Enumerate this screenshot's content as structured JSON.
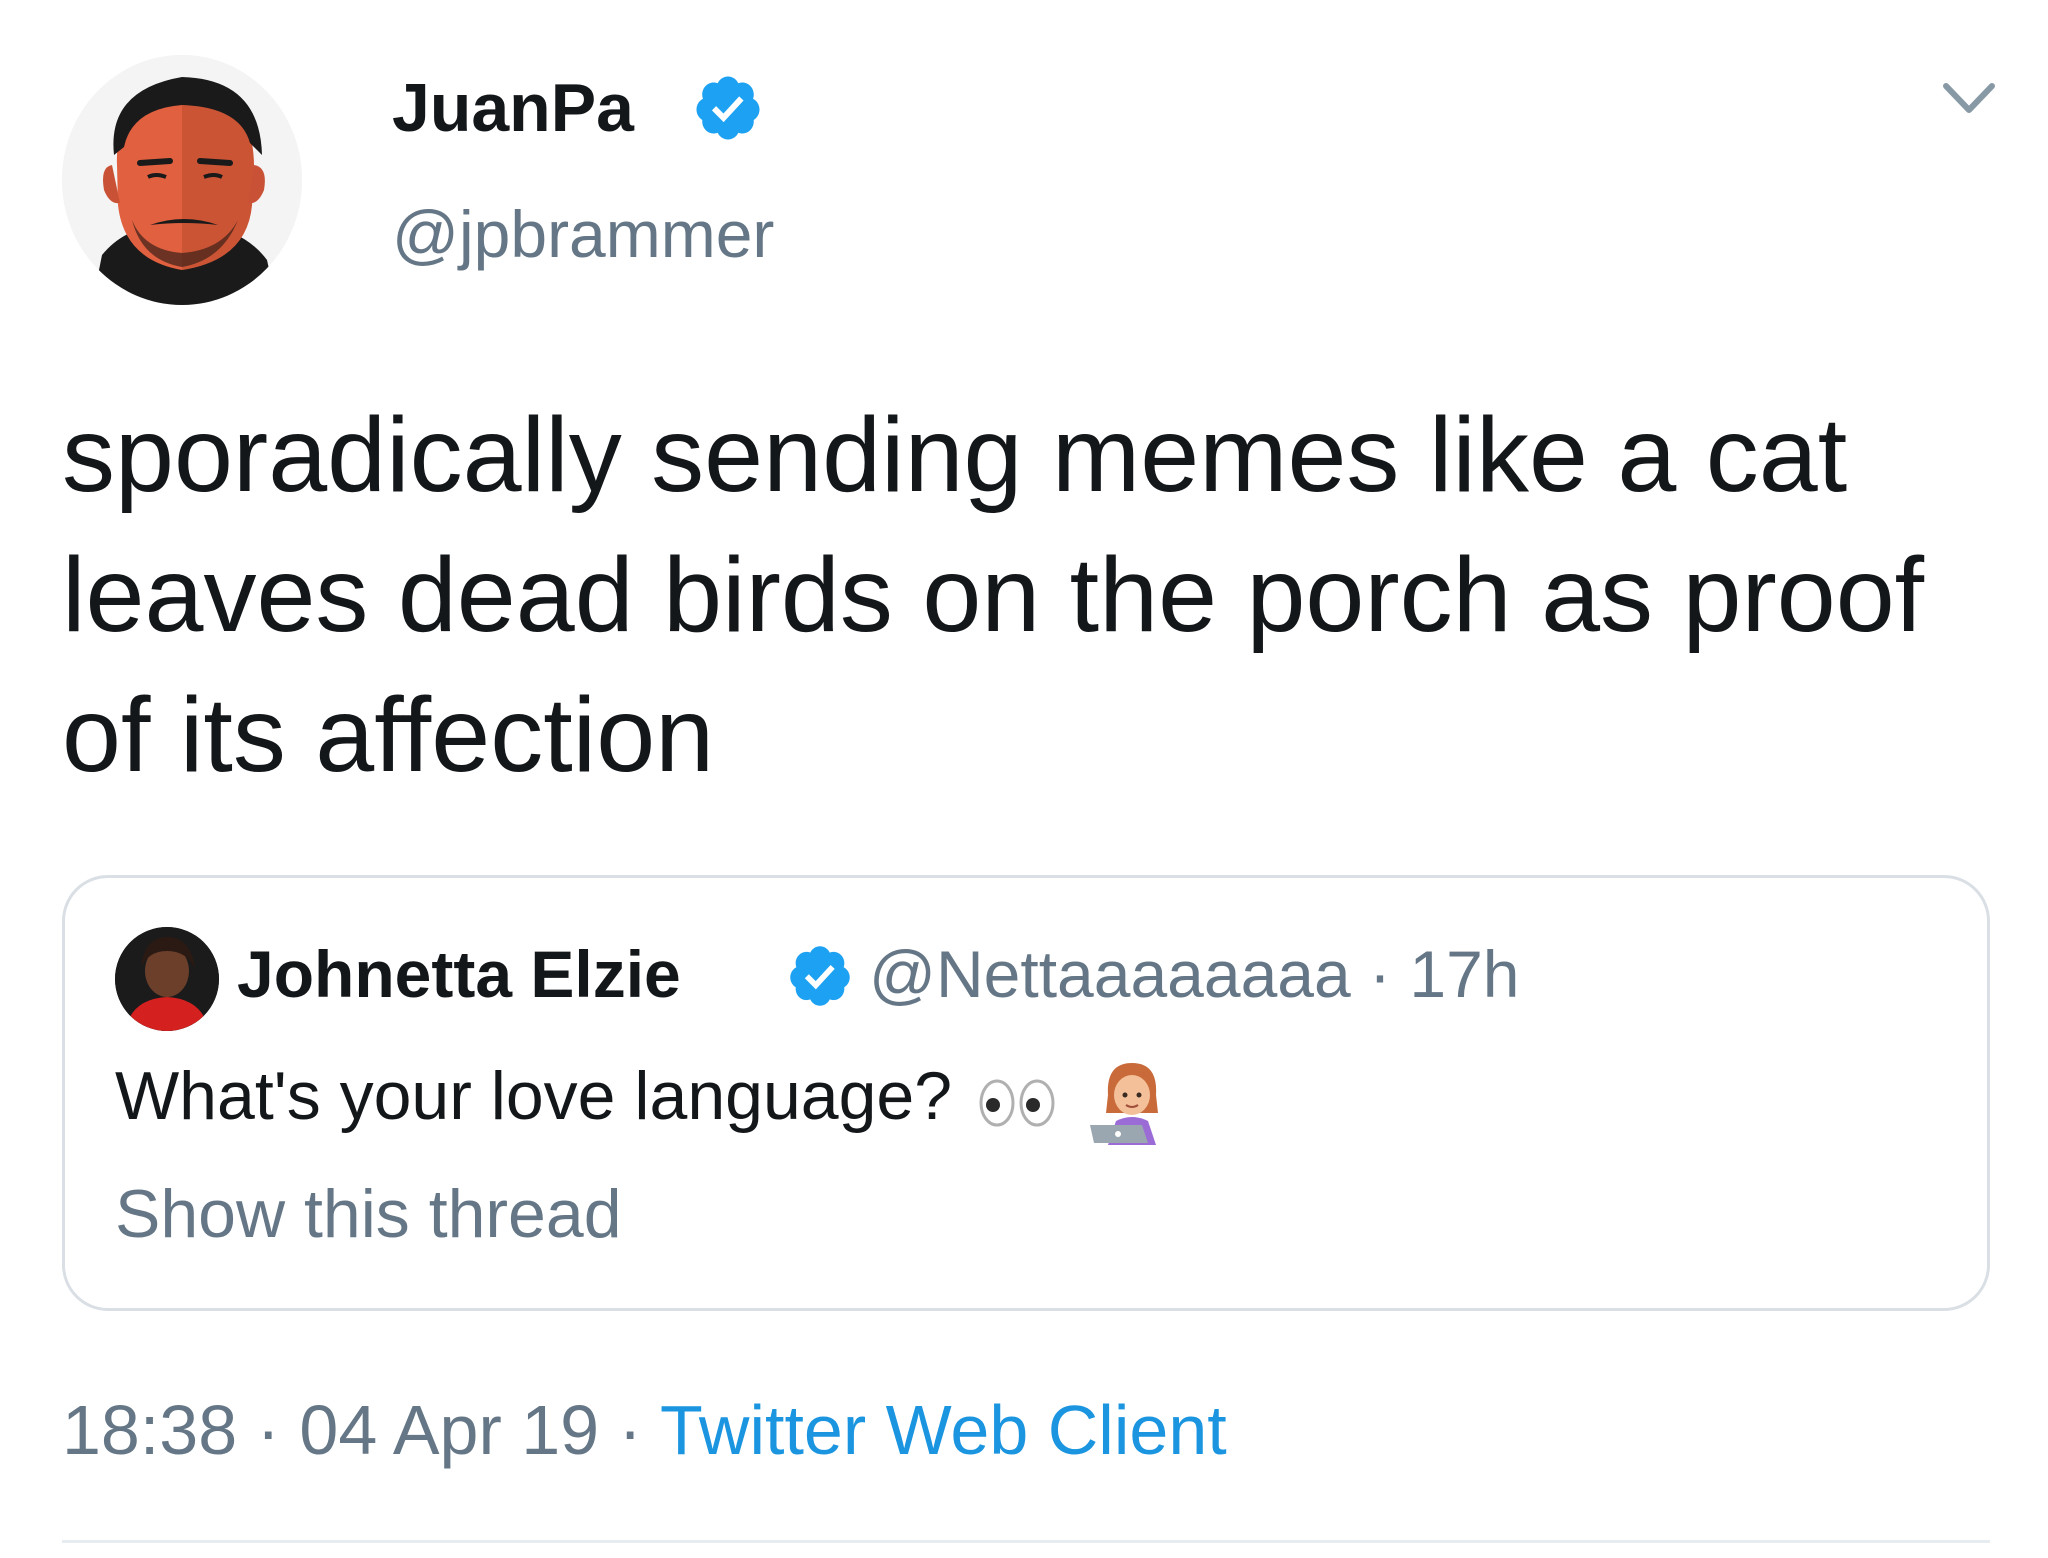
{
  "tweet": {
    "display_name": "JuanPa",
    "handle": "@jpbrammer",
    "verified": true,
    "text": "sporadically sending memes like a cat leaves dead birds on the porch as proof of its affection",
    "time": "18:38",
    "date": "04 Apr 19",
    "separator": "·",
    "source": "Twitter Web Client"
  },
  "quoted_tweet": {
    "display_name": "Johnetta Elzie",
    "handle": "@Nettaaaaaaaa",
    "time_ago": "17h",
    "separator": "·",
    "verified": true,
    "text": "What's your love language?",
    "emojis": [
      "eyes-emoji",
      "woman-technologist-emoji"
    ],
    "thread_link": "Show this thread"
  },
  "icons": {
    "verified": "verified-badge-icon",
    "menu": "chevron-down-icon"
  },
  "colors": {
    "verified_blue": "#1da1f2",
    "link_blue": "#1b95e0",
    "secondary_text": "#657786",
    "primary_text": "#14171a",
    "border": "#d9dfe4"
  }
}
